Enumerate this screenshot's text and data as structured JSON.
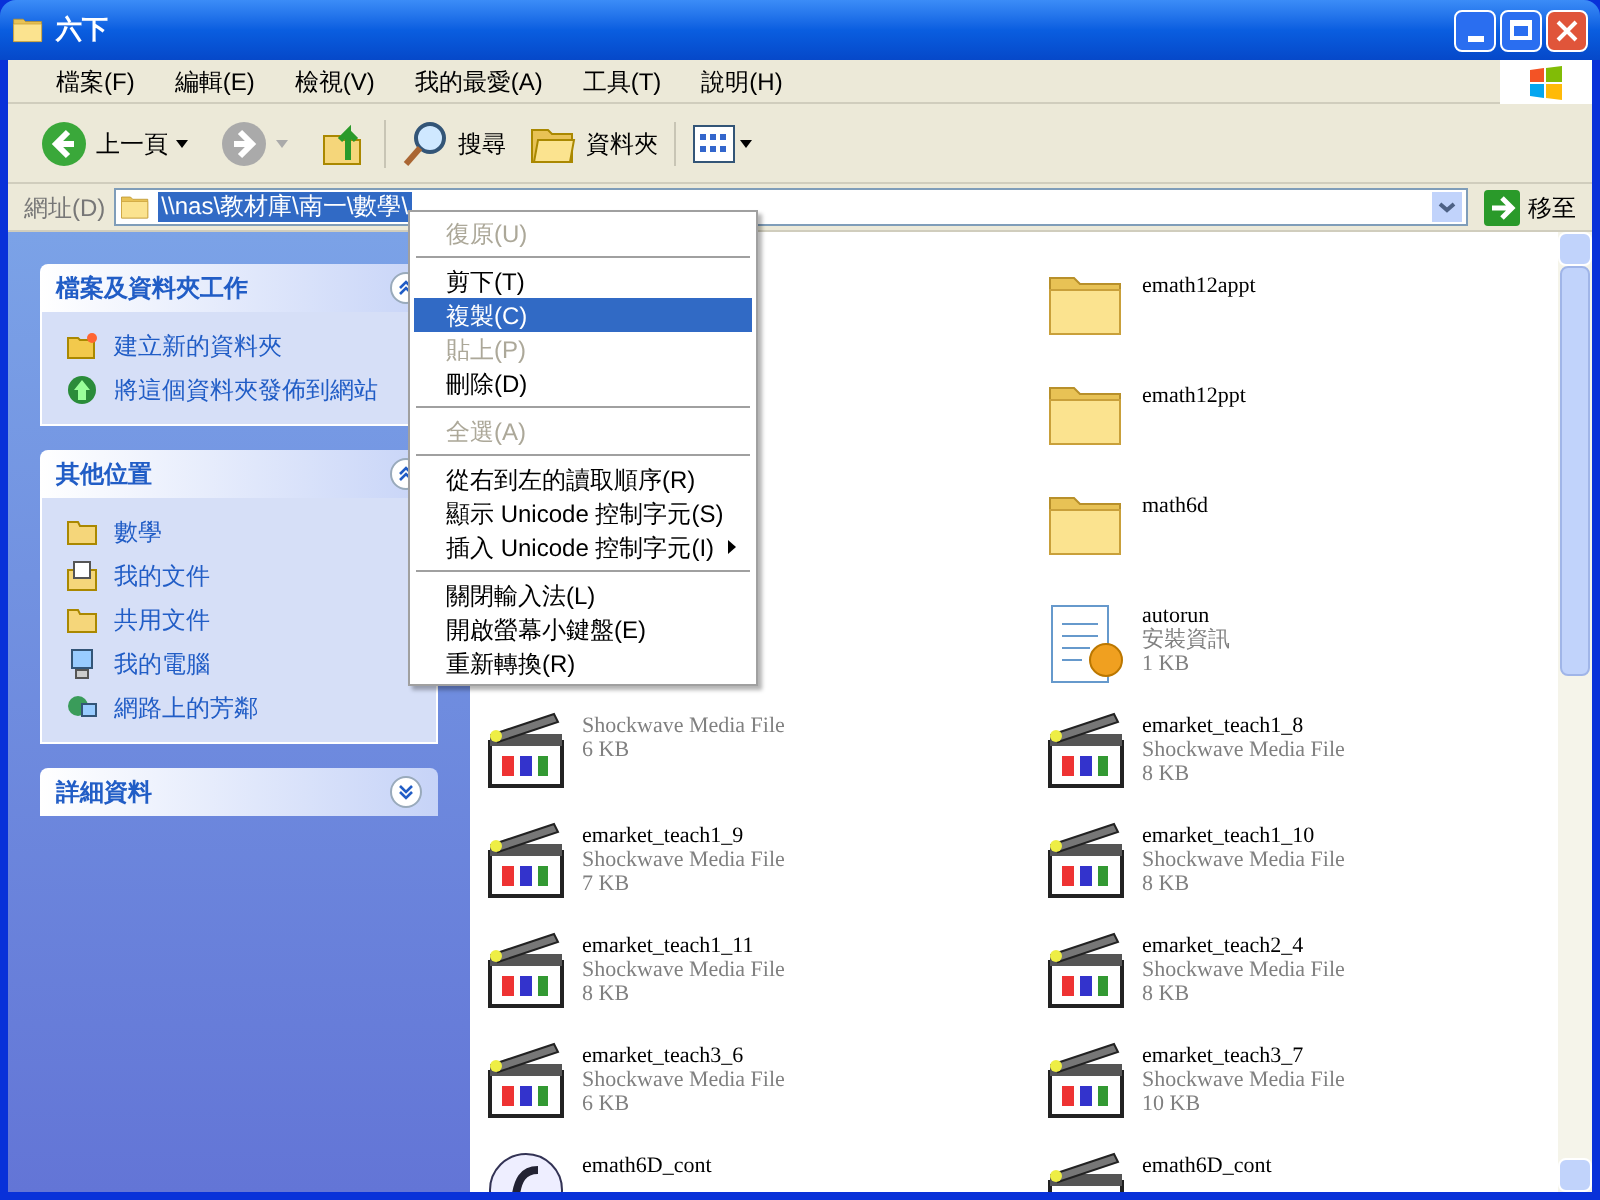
{
  "window": {
    "title": "六下"
  },
  "menu_bar": [
    "檔案(F)",
    "編輯(E)",
    "檢視(V)",
    "我的最愛(A)",
    "工具(T)",
    "說明(H)"
  ],
  "toolbar": {
    "back": "上一頁",
    "search": "搜尋",
    "folders": "資料夾"
  },
  "address": {
    "label": "網址(D)",
    "value": "\\\\nas\\教材庫\\南一\\數學\\",
    "selected": true,
    "go": "移至"
  },
  "sidebar": [
    {
      "title": "檔案及資料夾工作",
      "expanded": true,
      "items": [
        {
          "kind": "newfolder",
          "label": "建立新的資料夾"
        },
        {
          "kind": "publish",
          "label": "將這個資料夾發佈到網站"
        }
      ]
    },
    {
      "title": "其他位置",
      "expanded": true,
      "items": [
        {
          "kind": "folder",
          "label": "數學"
        },
        {
          "kind": "documents",
          "label": "我的文件"
        },
        {
          "kind": "folder",
          "label": "共用文件"
        },
        {
          "kind": "computer",
          "label": "我的電腦"
        },
        {
          "kind": "network",
          "label": "網路上的芳鄰"
        }
      ]
    },
    {
      "title": "詳細資料",
      "expanded": false
    }
  ],
  "files": [
    {
      "right": {
        "kind": "folder",
        "name": "emath12appt"
      }
    },
    {
      "right": {
        "kind": "folder",
        "name": "emath12ppt"
      }
    },
    {
      "right": {
        "kind": "folder",
        "name": "math6d"
      }
    },
    {
      "right": {
        "kind": "setup",
        "name": "autorun",
        "type": "安裝資訊",
        "size": "1 KB"
      }
    },
    {
      "left": {
        "kind": "shockwave",
        "type": "Shockwave Media File",
        "size": "6 KB"
      },
      "right": {
        "kind": "shockwave",
        "name": "emarket_teach1_8",
        "type": "Shockwave Media File",
        "size": "8 KB"
      }
    },
    {
      "left": {
        "kind": "shockwave",
        "name": "emarket_teach1_9",
        "type": "Shockwave Media File",
        "size": "7 KB"
      },
      "right": {
        "kind": "shockwave",
        "name": "emarket_teach1_10",
        "type": "Shockwave Media File",
        "size": "8 KB"
      }
    },
    {
      "left": {
        "kind": "shockwave",
        "name": "emarket_teach1_11",
        "type": "Shockwave Media File",
        "size": "8 KB"
      },
      "right": {
        "kind": "shockwave",
        "name": "emarket_teach2_4",
        "type": "Shockwave Media File",
        "size": "8 KB"
      }
    },
    {
      "left": {
        "kind": "shockwave",
        "name": "emarket_teach3_6",
        "type": "Shockwave Media File",
        "size": "6 KB"
      },
      "right": {
        "kind": "shockwave",
        "name": "emarket_teach3_7",
        "type": "Shockwave Media File",
        "size": "10 KB"
      }
    },
    {
      "left": {
        "kind": "flash",
        "name": "emath6D_cont"
      },
      "right": {
        "kind": "shockwave",
        "name": "emath6D_cont"
      }
    }
  ],
  "context_menu": [
    {
      "kind": "item",
      "label": "復原(U)",
      "disabled": true,
      "selected": false
    },
    {
      "kind": "separator"
    },
    {
      "kind": "item",
      "label": "剪下(T)",
      "disabled": false,
      "selected": false
    },
    {
      "kind": "item",
      "label": "複製(C)",
      "disabled": false,
      "selected": true
    },
    {
      "kind": "item",
      "label": "貼上(P)",
      "disabled": true,
      "selected": false
    },
    {
      "kind": "item",
      "label": "刪除(D)",
      "disabled": false,
      "selected": false
    },
    {
      "kind": "separator"
    },
    {
      "kind": "item",
      "label": "全選(A)",
      "disabled": true,
      "selected": false
    },
    {
      "kind": "separator"
    },
    {
      "kind": "item",
      "label": "從右到左的讀取順序(R)",
      "disabled": false,
      "selected": false
    },
    {
      "kind": "item",
      "label": "顯示 Unicode 控制字元(S)",
      "disabled": false,
      "selected": false
    },
    {
      "kind": "submenu",
      "label": "插入 Unicode 控制字元(I)",
      "disabled": false,
      "selected": false
    },
    {
      "kind": "separator"
    },
    {
      "kind": "item",
      "label": "關閉輸入法(L)",
      "disabled": false,
      "selected": false
    },
    {
      "kind": "item",
      "label": "開啟螢幕小鍵盤(E)",
      "disabled": false,
      "selected": false
    },
    {
      "kind": "item",
      "label": "重新轉換(R)",
      "disabled": false,
      "selected": false
    }
  ]
}
